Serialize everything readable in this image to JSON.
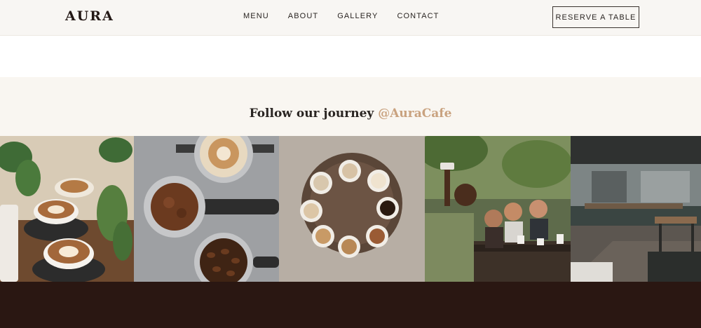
{
  "brand": {
    "logo": "AURA"
  },
  "nav": {
    "items": [
      {
        "label": "MENU"
      },
      {
        "label": "ABOUT"
      },
      {
        "label": "GALLERY"
      },
      {
        "label": "CONTACT"
      }
    ],
    "cta_label": "RESERVE A TABLE"
  },
  "follow": {
    "title": "Follow our journey",
    "handle": "@AuraCafe"
  },
  "gallery": {
    "photos": [
      {
        "subject": "latte art cups and plants"
      },
      {
        "subject": "portafilters with ground coffee and beans"
      },
      {
        "subject": "coffee cups arranged on round wooden tray"
      },
      {
        "subject": "friends taking a selfie at a cafe table"
      },
      {
        "subject": "cafe interior"
      }
    ]
  },
  "colors": {
    "header_bg": "#f8f6f3",
    "section_bg": "#f9f6f1",
    "accent": "#c9a27f",
    "footer_bg": "#2a1712",
    "text_dark": "#2a2522"
  }
}
